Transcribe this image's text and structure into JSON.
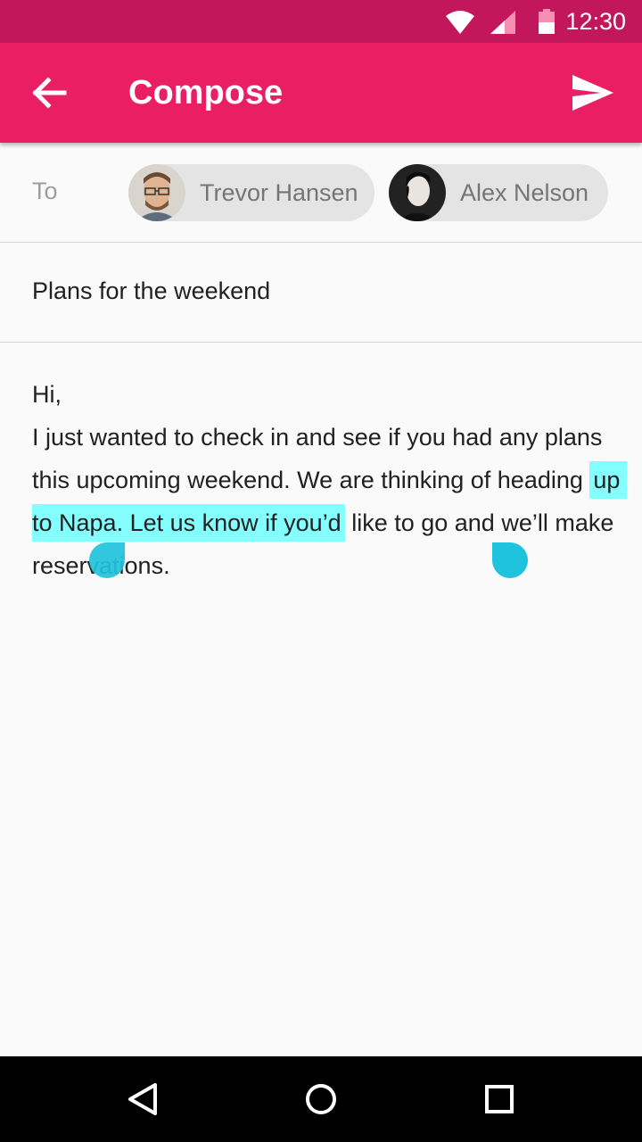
{
  "status_bar": {
    "time": "12:30",
    "icons": [
      "wifi-icon",
      "signal-icon",
      "battery-icon"
    ]
  },
  "app_bar": {
    "title": "Compose",
    "back_icon": "arrow-back-icon",
    "send_icon": "send-icon"
  },
  "to": {
    "label": "To",
    "recipients": [
      {
        "name": "Trevor Hansen"
      },
      {
        "name": "Alex Nelson"
      }
    ]
  },
  "subject": "Plans for the weekend",
  "body": {
    "before": "Hi,\nI just wanted to check in and see if you had any plans this upcoming weekend. We are thinking of heading ",
    "selected": "up to Napa. Let us know if you’d",
    "after": " like to go and we’ll make reservations."
  },
  "colors": {
    "status_bar": "#c2185b",
    "app_bar": "#e91e63",
    "selection": "#84ffff",
    "handle": "#1fc3dc"
  },
  "nav_bar": {
    "icons": [
      "nav-back-icon",
      "nav-home-icon",
      "nav-recents-icon"
    ]
  }
}
